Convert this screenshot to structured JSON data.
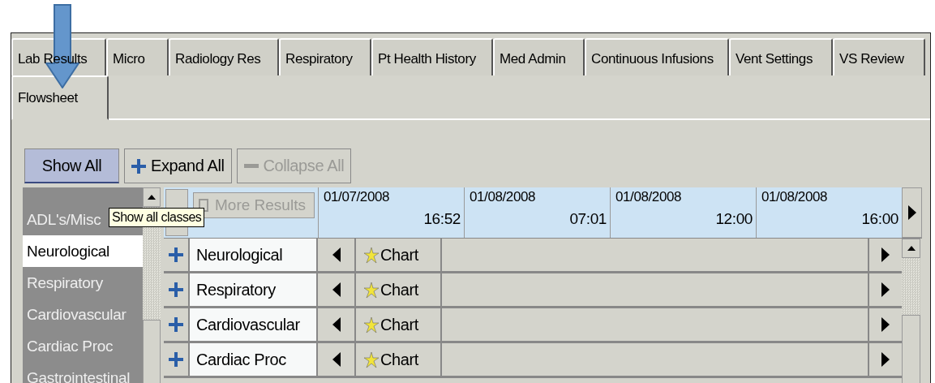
{
  "tab_rows": [
    {
      "tabs": [
        {
          "label": "Lab Results",
          "selected": false
        },
        {
          "label": "Micro",
          "selected": false
        },
        {
          "label": "Radiology Res",
          "selected": false
        },
        {
          "label": "Respiratory",
          "selected": false
        },
        {
          "label": "Pt Health History",
          "selected": false
        },
        {
          "label": "Med Admin",
          "selected": false
        },
        {
          "label": "Continuous Infusions",
          "selected": false
        },
        {
          "label": "Vent Settings",
          "selected": false
        },
        {
          "label": "VS Review",
          "selected": false
        }
      ]
    },
    {
      "tabs": [
        {
          "label": "Flowsheet",
          "selected": true
        }
      ]
    }
  ],
  "toolbar": [
    {
      "label": "Show All",
      "kind": "plain",
      "disabled": false
    },
    {
      "label": "Expand All",
      "kind": "expand",
      "disabled": false
    },
    {
      "label": "Collapse All",
      "kind": "collapse",
      "disabled": true
    }
  ],
  "sidebar": {
    "items": [
      {
        "label": "ADL's/Misc",
        "selected": false
      },
      {
        "label": "Neurological",
        "selected": true
      },
      {
        "label": "Respiratory",
        "selected": false
      },
      {
        "label": "Cardiovascular",
        "selected": false
      },
      {
        "label": "Cardiac Proc",
        "selected": false
      },
      {
        "label": "Gastrointestinal",
        "selected": false
      }
    ],
    "tooltip": "Show all classes"
  },
  "grid": {
    "more_results": {
      "label": "More Results",
      "disabled": true
    },
    "columns": [
      {
        "date": "01/07/2008",
        "time": "16:52"
      },
      {
        "date": "01/08/2008",
        "time": "07:01"
      },
      {
        "date": "01/08/2008",
        "time": "12:00"
      },
      {
        "date": "01/08/2008",
        "time": "16:00"
      }
    ],
    "rows": [
      {
        "label": "Neurological",
        "action": "Chart"
      },
      {
        "label": "Respiratory",
        "action": "Chart"
      },
      {
        "label": "Cardiovascular",
        "action": "Chart"
      },
      {
        "label": "Cardiac Proc",
        "action": "Chart"
      }
    ]
  }
}
